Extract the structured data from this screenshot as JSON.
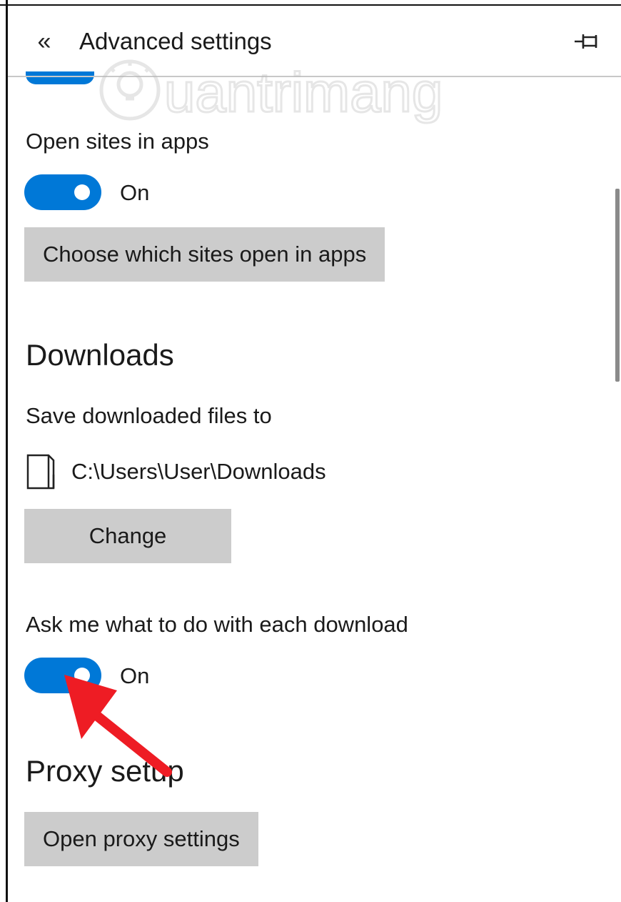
{
  "header": {
    "back_glyph": "«",
    "title": "Advanced settings",
    "pin_icon": "pin-icon"
  },
  "watermark": {
    "text": "uantrimang",
    "icon": "lightbulb-icon"
  },
  "open_sites": {
    "label": "Open sites in apps",
    "toggle_state": "On",
    "button_label": "Choose which sites open in apps"
  },
  "downloads": {
    "heading": "Downloads",
    "save_label": "Save downloaded files to",
    "folder_icon": "folder-icon",
    "path": "C:\\Users\\User\\Downloads",
    "change_label": "Change",
    "ask_label": "Ask me what to do with each download",
    "ask_toggle_state": "On"
  },
  "proxy": {
    "heading": "Proxy setup",
    "button_label": "Open proxy settings"
  },
  "colors": {
    "accent": "#0078d7",
    "button_bg": "#cccccc",
    "annotation_arrow": "#ee1c24"
  }
}
